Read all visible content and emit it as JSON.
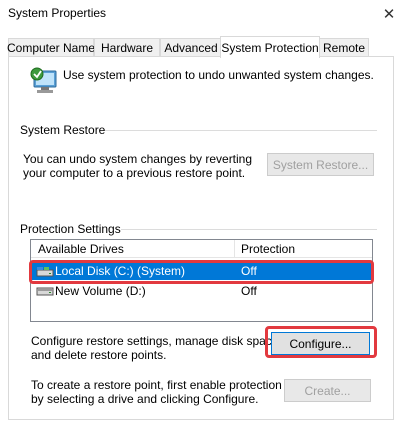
{
  "window": {
    "title": "System Properties",
    "close_glyph": "✕"
  },
  "tabs": [
    {
      "label": "Computer Name"
    },
    {
      "label": "Hardware"
    },
    {
      "label": "Advanced"
    },
    {
      "label": "System Protection",
      "active": true
    },
    {
      "label": "Remote"
    }
  ],
  "intro": {
    "icon": "system-protection-icon",
    "text": "Use system protection to undo unwanted system changes."
  },
  "system_restore": {
    "group_title": "System Restore",
    "description_line1": "You can undo system changes by reverting",
    "description_line2": "your computer to a previous restore point.",
    "button_label": "System Restore..."
  },
  "protection_settings": {
    "group_title": "Protection Settings",
    "columns": [
      "Available Drives",
      "Protection"
    ],
    "drives": [
      {
        "name": "Local Disk (C:) (System)",
        "protection": "Off",
        "icon": "system-drive-icon",
        "selected": true
      },
      {
        "name": "New Volume (D:)",
        "protection": "Off",
        "icon": "drive-icon",
        "selected": false
      }
    ],
    "configure_text_line1": "Configure restore settings, manage disk space,",
    "configure_text_line2": "and delete restore points.",
    "configure_button": "Configure...",
    "create_text_line1": "To create a restore point, first enable protection",
    "create_text_line2": "by selecting a drive and clicking Configure.",
    "create_button": "Create..."
  },
  "colors": {
    "selection": "#0078d7",
    "highlight_annotation": "#e2393f"
  }
}
